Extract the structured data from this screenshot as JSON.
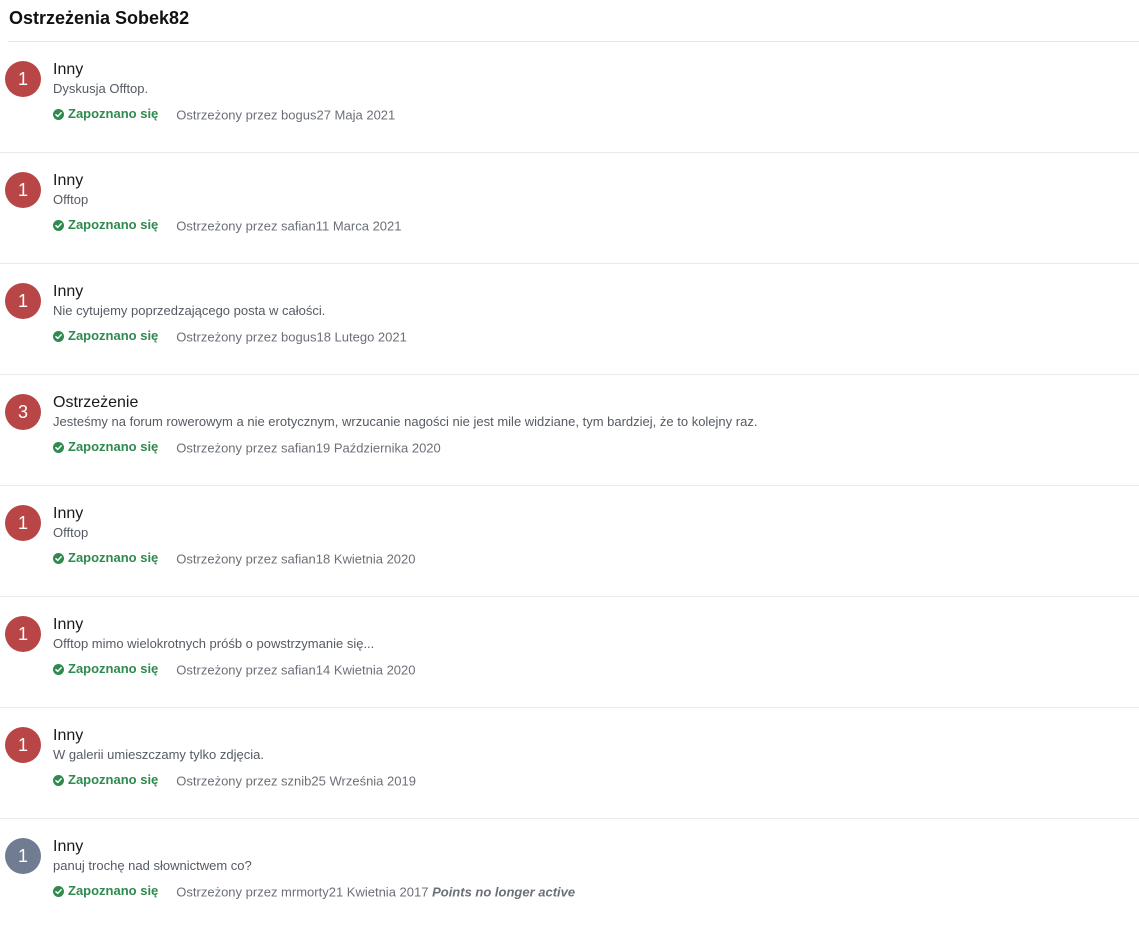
{
  "header": {
    "title": "Ostrzeżenia Sobek82"
  },
  "colors": {
    "badge_active": "#b94646",
    "badge_inactive": "#6f7c91",
    "acknowledged": "#2f8a4e"
  },
  "warnings": [
    {
      "points": "1",
      "type": "Inny",
      "reason": "Dyskusja Offtop.",
      "ack_label": "Zapoznano się",
      "meta": "Ostrzeżony przez bogus27 Maja 2021",
      "inactive_note": "",
      "active": true
    },
    {
      "points": "1",
      "type": "Inny",
      "reason": "Offtop",
      "ack_label": "Zapoznano się",
      "meta": "Ostrzeżony przez safian11 Marca 2021",
      "inactive_note": "",
      "active": true
    },
    {
      "points": "1",
      "type": "Inny",
      "reason": "Nie cytujemy poprzedzającego posta w całości.",
      "ack_label": "Zapoznano się",
      "meta": "Ostrzeżony przez bogus18 Lutego 2021",
      "inactive_note": "",
      "active": true
    },
    {
      "points": "3",
      "type": "Ostrzeżenie",
      "reason": "Jesteśmy na forum rowerowym a nie erotycznym, wrzucanie nagości nie jest mile widziane, tym bardziej, że to kolejny raz.",
      "ack_label": "Zapoznano się",
      "meta": "Ostrzeżony przez safian19 Października 2020",
      "inactive_note": "",
      "active": true
    },
    {
      "points": "1",
      "type": "Inny",
      "reason": "Offtop",
      "ack_label": "Zapoznano się",
      "meta": "Ostrzeżony przez safian18 Kwietnia 2020",
      "inactive_note": "",
      "active": true
    },
    {
      "points": "1",
      "type": "Inny",
      "reason": "Offtop mimo wielokrotnych próśb o powstrzymanie się...",
      "ack_label": "Zapoznano się",
      "meta": "Ostrzeżony przez safian14 Kwietnia 2020",
      "inactive_note": "",
      "active": true
    },
    {
      "points": "1",
      "type": "Inny",
      "reason": "W galerii umieszczamy tylko zdjęcia.",
      "ack_label": "Zapoznano się",
      "meta": "Ostrzeżony przez sznib25 Września 2019",
      "inactive_note": "",
      "active": true
    },
    {
      "points": "1",
      "type": "Inny",
      "reason": "panuj trochę nad słownictwem co?",
      "ack_label": "Zapoznano się",
      "meta": "Ostrzeżony przez mrmorty21 Kwietnia 2017",
      "inactive_note": "Points no longer active",
      "active": false
    }
  ]
}
